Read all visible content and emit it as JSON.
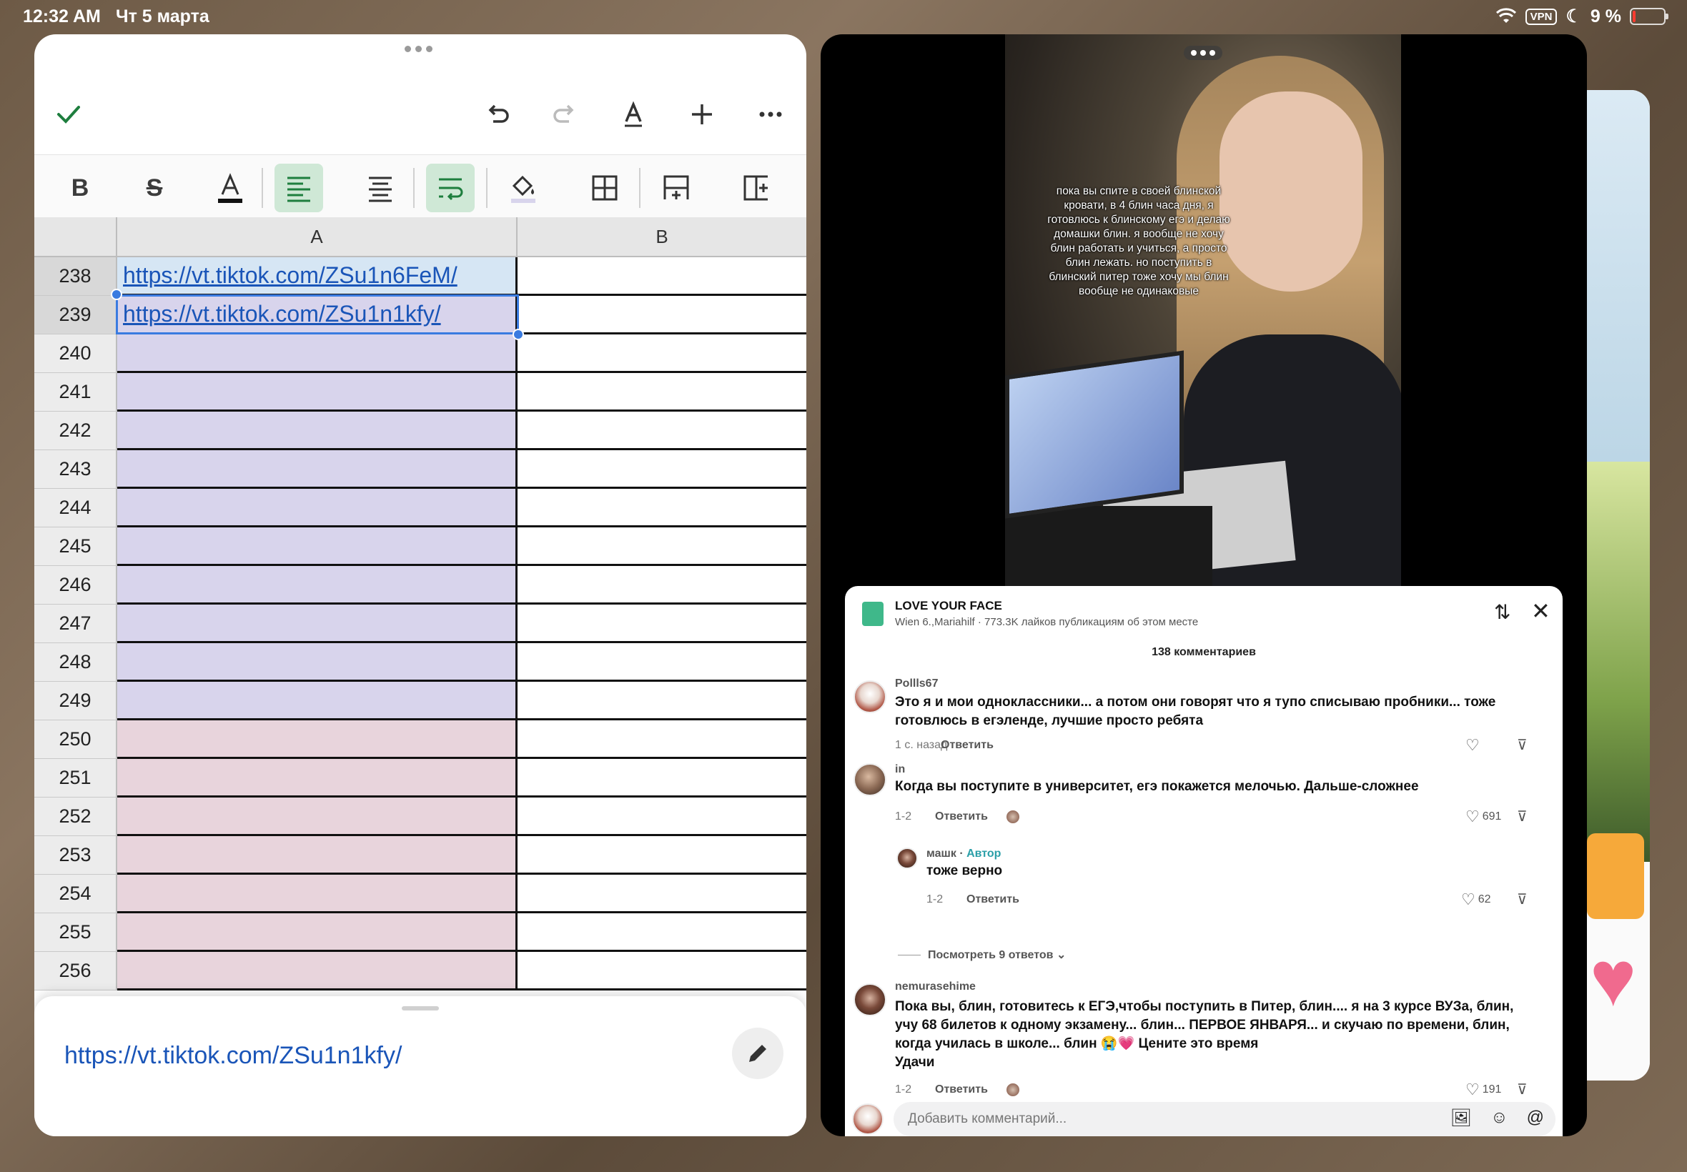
{
  "status_bar": {
    "time": "12:32 AM",
    "date": "Чт 5 марта",
    "vpn": "VPN",
    "battery_text": "9 %",
    "battery_level": 0.09
  },
  "spreadsheet": {
    "columns": [
      "A",
      "B"
    ],
    "rows": [
      {
        "num": "238",
        "a": "https://vt.tiktok.com/ZSu1n6FeM/",
        "fill": "#d6e6f4"
      },
      {
        "num": "239",
        "a": "https://vt.tiktok.com/ZSu1n1kfy/",
        "fill": "#d8d4ec"
      },
      {
        "num": "240",
        "a": "",
        "fill": "#d8d4ec"
      },
      {
        "num": "241",
        "a": "",
        "fill": "#d8d4ec"
      },
      {
        "num": "242",
        "a": "",
        "fill": "#d8d4ec"
      },
      {
        "num": "243",
        "a": "",
        "fill": "#d8d4ec"
      },
      {
        "num": "244",
        "a": "",
        "fill": "#d8d4ec"
      },
      {
        "num": "245",
        "a": "",
        "fill": "#d8d4ec"
      },
      {
        "num": "246",
        "a": "",
        "fill": "#d8d4ec"
      },
      {
        "num": "247",
        "a": "",
        "fill": "#d8d4ec"
      },
      {
        "num": "248",
        "a": "",
        "fill": "#d8d4ec"
      },
      {
        "num": "249",
        "a": "",
        "fill": "#d8d4ec"
      },
      {
        "num": "250",
        "a": "",
        "fill": "#e8d4dc"
      },
      {
        "num": "251",
        "a": "",
        "fill": "#e8d4dc"
      },
      {
        "num": "252",
        "a": "",
        "fill": "#e8d4dc"
      },
      {
        "num": "253",
        "a": "",
        "fill": "#e8d4dc"
      },
      {
        "num": "254",
        "a": "",
        "fill": "#e8d4dc"
      },
      {
        "num": "255",
        "a": "",
        "fill": "#e8d4dc"
      },
      {
        "num": "256",
        "a": "",
        "fill": "#e8d4dc"
      }
    ],
    "selected_rows": [
      "238",
      "239"
    ],
    "cell_editor_value": "https://vt.tiktok.com/ZSu1n1kfy/",
    "accent": "#1e7e3e"
  },
  "video": {
    "caption": "пока вы спите в своей блинской кровати, в 4 блин часа дня, я готовлюсь к блинскому егэ и делаю домашки блин. я вообще не хочу блин работать и учиться, а просто блин лежать. но поступить в блинский питер тоже хочу мы блин вообще не одинаковые"
  },
  "comments": {
    "place_title": "LOVE YOUR FACE",
    "place_sub": "Wien 6.,Mariahilf · 773.3K лайков публикациям об этом месте",
    "count_label": "138 комментариев",
    "items": [
      {
        "user": "Pollls67",
        "text_1": "Это я и мои одноклассники... а потом они говорят что я тупо списываю пробники... тоже",
        "text_2": "готовлюсь в егэленде, лучшие просто ребята",
        "meta": "1 с. назад",
        "reply": "Ответить",
        "likes": ""
      },
      {
        "user": "in",
        "text_1": "Когда вы поступите в университет, егэ покажется мелочью. Дальше-сложнее",
        "meta": "1-2",
        "reply": "Ответить",
        "likes": "691"
      },
      {
        "user": "машк",
        "author_badge": "Автор",
        "text_1": "тоже верно",
        "meta": "1-2",
        "reply": "Ответить",
        "likes": "62"
      },
      {
        "user": "nemurasehime",
        "text_1": "Пока вы, блин, готовитесь к ЕГЭ,чтобы поступить в Питер, блин.... я на 3 курсе ВУЗа, блин,",
        "text_2": "учу 68 билетов к одному экзамену... блин... ПЕРВОЕ ЯНВАРЯ... и скучаю по времени, блин,",
        "text_3": "когда училась в школе... блин 😭💗 Цените это время",
        "text_4": "Удачи",
        "meta": "1-2",
        "reply": "Ответить",
        "likes": "191"
      }
    ],
    "view_replies": "Посмотреть 9 ответов",
    "input_placeholder": "Добавить комментарий..."
  }
}
